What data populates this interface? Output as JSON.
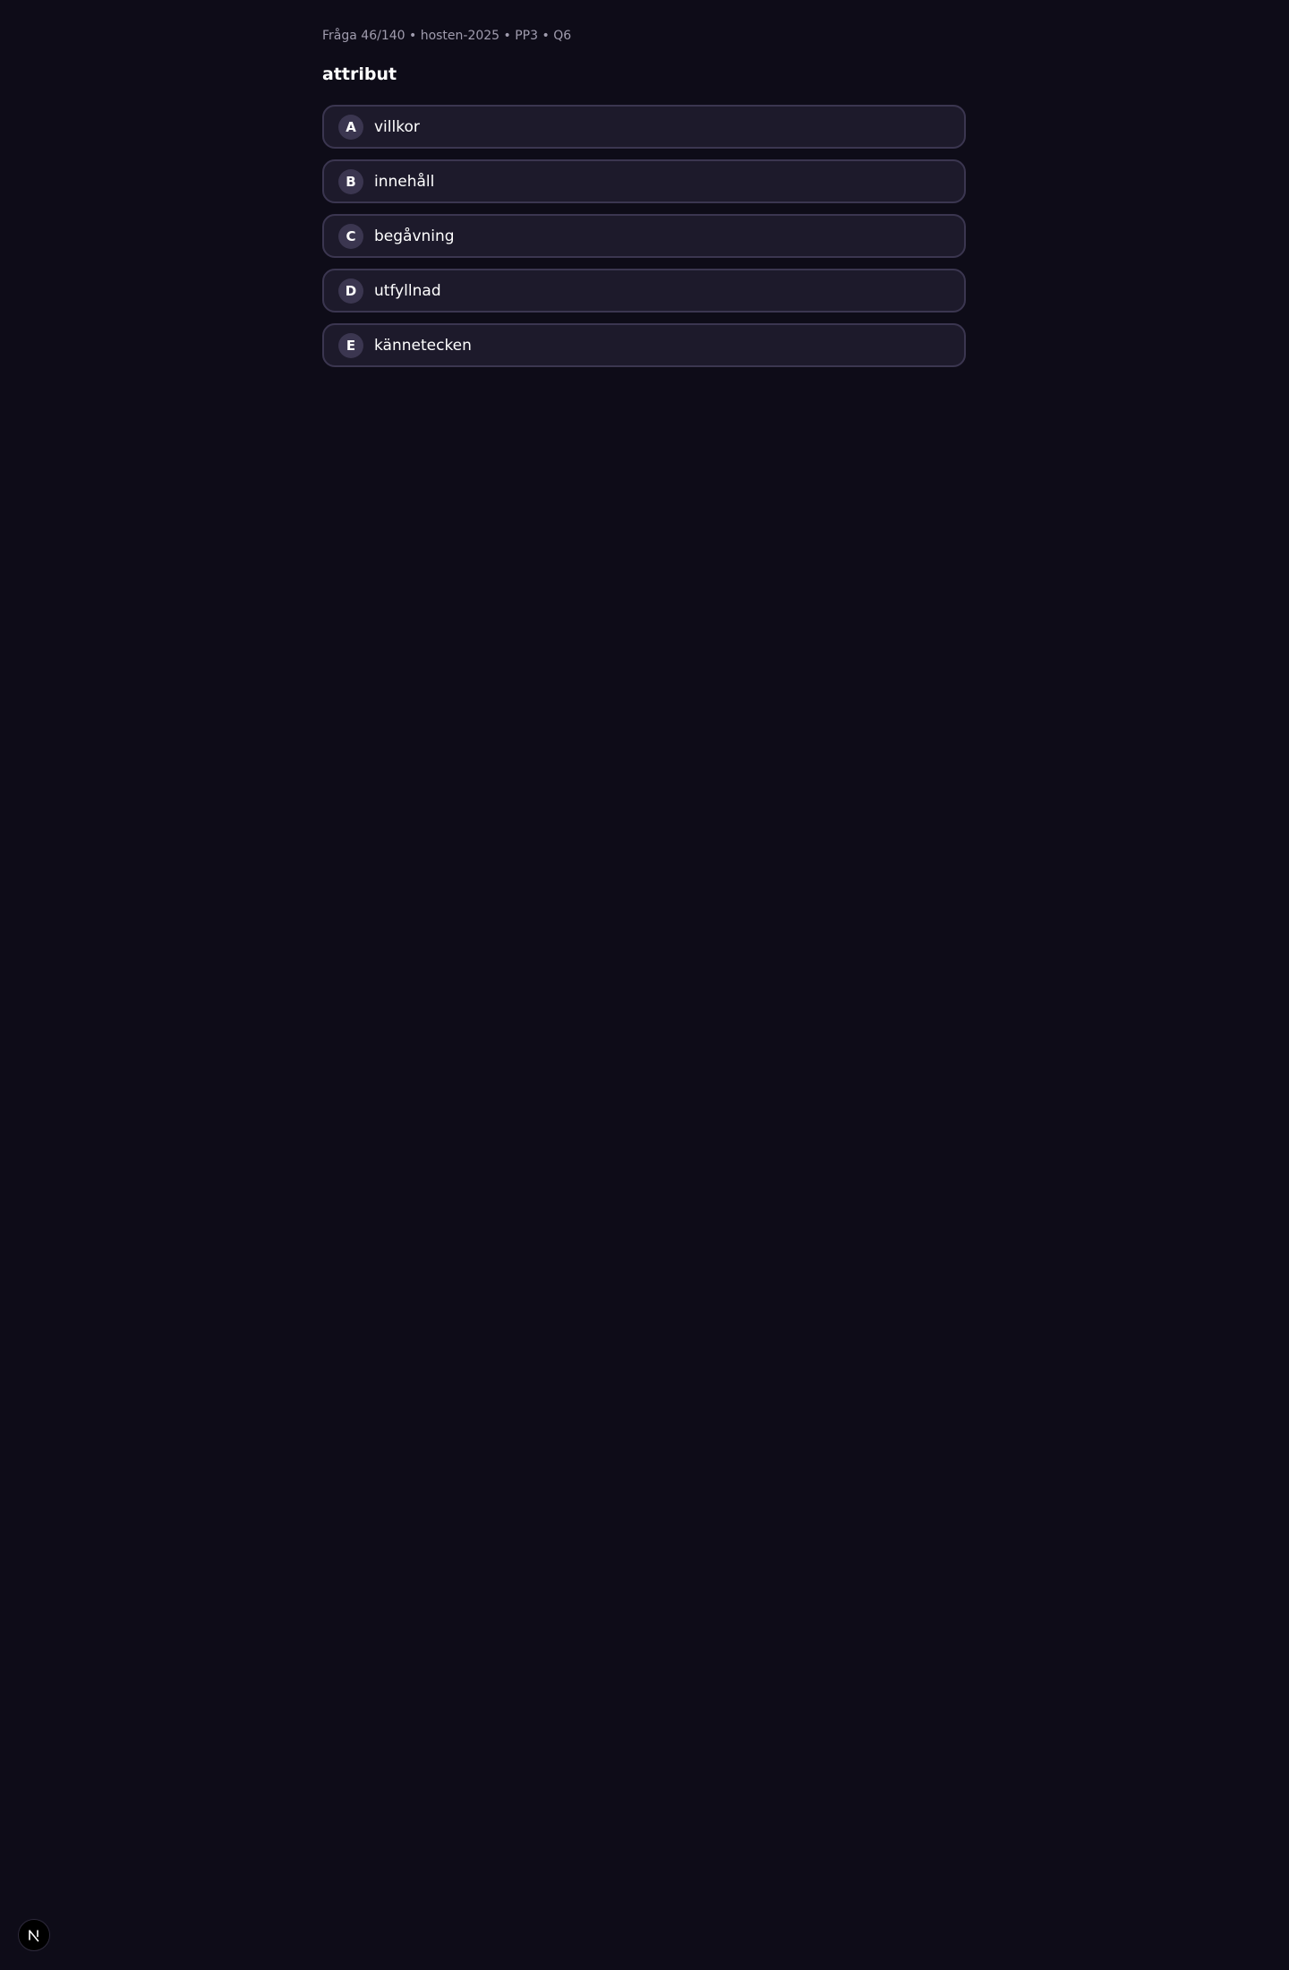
{
  "question": {
    "meta": "Fråga 46/140 • hosten-2025 • PP3 • Q6",
    "word": "attribut"
  },
  "options": [
    {
      "letter": "A",
      "text": "villkor"
    },
    {
      "letter": "B",
      "text": "innehåll"
    },
    {
      "letter": "C",
      "text": "begåvning"
    },
    {
      "letter": "D",
      "text": "utfyllnad"
    },
    {
      "letter": "E",
      "text": "kännetecken"
    }
  ],
  "dev_badge": {
    "icon": "n-logo-icon"
  },
  "colors": {
    "background": "#0e0c18",
    "option_background": "#1d1a2b",
    "option_border": "#3b3650",
    "meta_text": "#a09cae"
  }
}
